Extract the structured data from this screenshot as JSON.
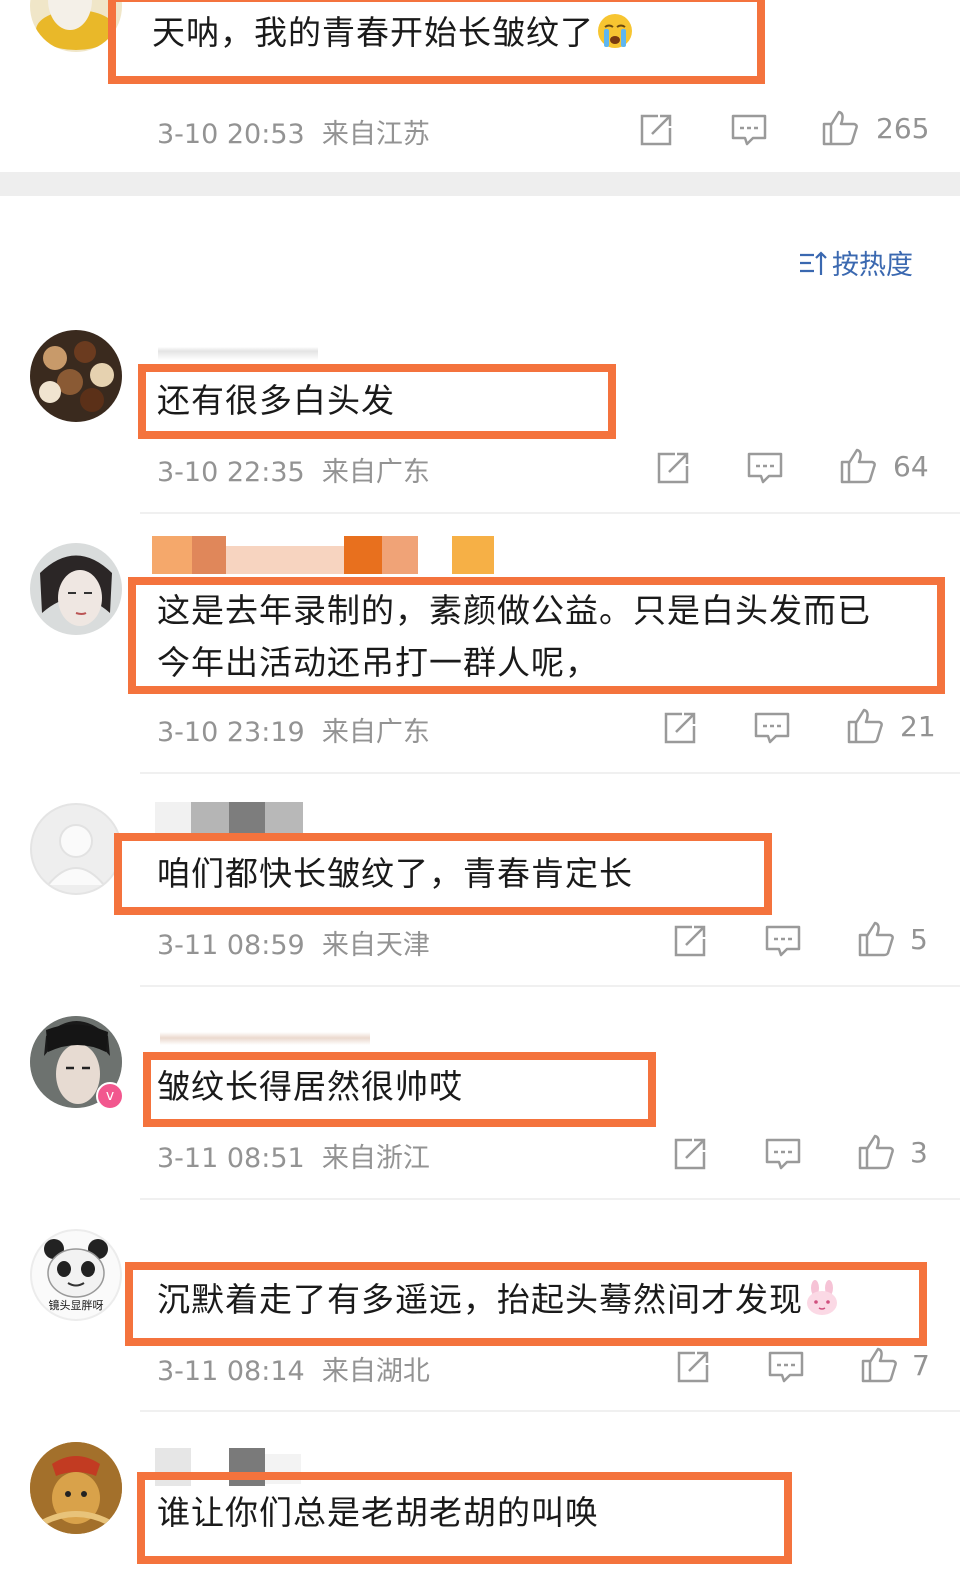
{
  "sort": {
    "label": "按热度",
    "icon": "sort-icon"
  },
  "top_comment": {
    "text": "天呐，我的青春开始长皱纹了",
    "emoji": "crying-face",
    "time": "3-10 20:53",
    "location": "来自江苏",
    "likes": "265"
  },
  "comments": [
    {
      "lines": [
        "还有很多白头发"
      ],
      "time": "3-10 22:35",
      "location": "来自广东",
      "likes": "64"
    },
    {
      "lines": [
        "这是去年录制的，素颜做公益。只是白头发而已",
        "今年出活动还吊打一群人呢，"
      ],
      "time": "3-10 23:19",
      "location": "来自广东",
      "likes": "21"
    },
    {
      "lines": [
        "咱们都快长皱纹了，青春肯定长"
      ],
      "time": "3-11 08:59",
      "location": "来自天津",
      "likes": "5"
    },
    {
      "lines": [
        "皱纹长得居然很帅哎"
      ],
      "time": "3-11 08:51",
      "location": "来自浙江",
      "likes": "3"
    },
    {
      "lines": [
        "沉默着走了有多遥远，抬起头蓦然间才发现"
      ],
      "emoji": "bunny",
      "time": "3-11 08:14",
      "location": "来自湖北",
      "likes": "7"
    },
    {
      "lines": [
        "谁让你们总是老胡老胡的叫唤"
      ]
    }
  ],
  "avatar_caption": "镜头显胖呀",
  "icons": {
    "share": "share-icon",
    "reply": "comment-icon",
    "like": "thumbs-up-icon"
  },
  "colors": {
    "highlight": "#f4733d",
    "meta": "#939393",
    "accent": "#3a68b0"
  }
}
